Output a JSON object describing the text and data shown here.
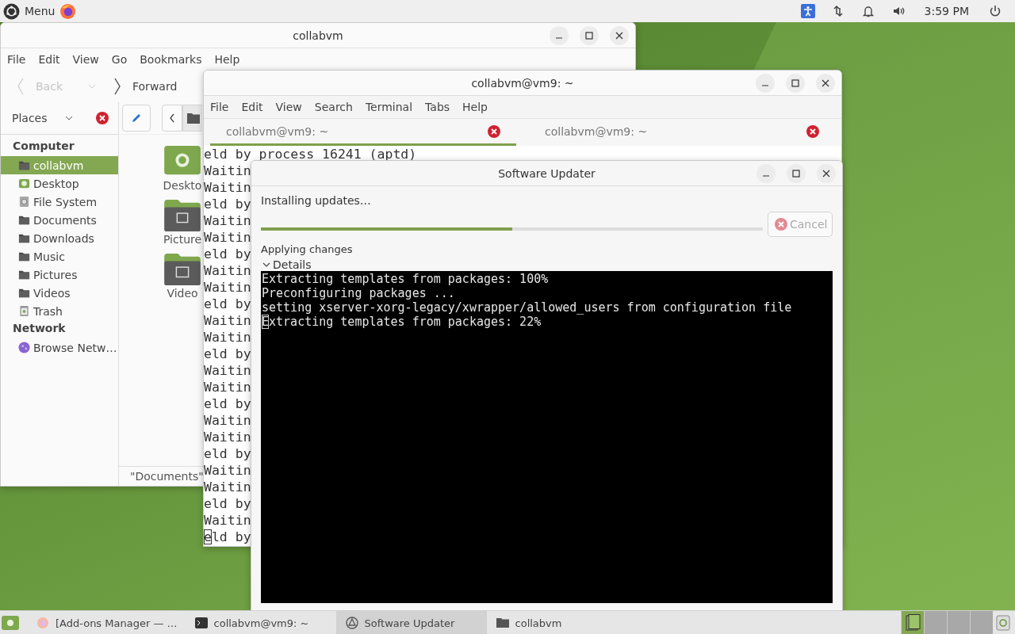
{
  "top_panel": {
    "menu_label": "Menu",
    "clock": "3:59 PM"
  },
  "file_manager": {
    "title": "collabvm",
    "menu": [
      "File",
      "Edit",
      "View",
      "Go",
      "Bookmarks",
      "Help"
    ],
    "toolbar": [
      {
        "kind": "back",
        "label": "Back",
        "disabled": true
      },
      {
        "kind": "forward",
        "label": "Forward",
        "disabled": false
      }
    ],
    "places_label": "Places",
    "sidebar": [
      {
        "heading": "Computer",
        "items": [
          {
            "label": "collabvm",
            "kind": "home",
            "selected": true
          },
          {
            "label": "Desktop",
            "kind": "desktop",
            "selected": false
          },
          {
            "label": "File System",
            "kind": "drive",
            "selected": false
          },
          {
            "label": "Documents",
            "kind": "folder",
            "selected": false
          },
          {
            "label": "Downloads",
            "kind": "folder",
            "selected": false
          },
          {
            "label": "Music",
            "kind": "folder",
            "selected": false
          },
          {
            "label": "Pictures",
            "kind": "folder",
            "selected": false
          },
          {
            "label": "Videos",
            "kind": "folder",
            "selected": false
          },
          {
            "label": "Trash",
            "kind": "trash",
            "selected": false
          }
        ]
      },
      {
        "heading": "Network",
        "items": [
          {
            "label": "Browse Netw…",
            "kind": "network",
            "selected": false
          }
        ]
      }
    ],
    "files": [
      {
        "label": "Deskto",
        "kind": "desktop"
      },
      {
        "label": "Picture",
        "kind": "pictures"
      },
      {
        "label": "Video",
        "kind": "videos"
      }
    ],
    "status": "\"Documents\""
  },
  "terminal": {
    "title": "collabvm@vm9: ~",
    "menu": [
      "File",
      "Edit",
      "View",
      "Search",
      "Terminal",
      "Tabs",
      "Help"
    ],
    "tabs": [
      {
        "label": "collabvm@vm9: ~",
        "selected": true
      },
      {
        "label": "collabvm@vm9: ~",
        "selected": false
      }
    ],
    "lines": [
      {
        "text": "eld by process 16241 (aptd)",
        "cursor": false
      },
      {
        "text": "Waitin",
        "cursor": false
      },
      {
        "text": "Waitin",
        "cursor": false
      },
      {
        "text": "eld by",
        "cursor": false
      },
      {
        "text": "Waitin",
        "cursor": false
      },
      {
        "text": "Waitin",
        "cursor": false
      },
      {
        "text": "eld by",
        "cursor": false
      },
      {
        "text": "Waitin",
        "cursor": false
      },
      {
        "text": "Waitin",
        "cursor": false
      },
      {
        "text": "eld by",
        "cursor": false
      },
      {
        "text": "Waitin",
        "cursor": false
      },
      {
        "text": "Waitin",
        "cursor": false
      },
      {
        "text": "eld by",
        "cursor": false
      },
      {
        "text": "Waitin",
        "cursor": false
      },
      {
        "text": "Waitin",
        "cursor": false
      },
      {
        "text": "eld by",
        "cursor": false
      },
      {
        "text": "Waitin",
        "cursor": false
      },
      {
        "text": "Waitin",
        "cursor": false
      },
      {
        "text": "eld by",
        "cursor": false
      },
      {
        "text": "Waitin",
        "cursor": false
      },
      {
        "text": "Waitin",
        "cursor": false
      },
      {
        "text": "eld by",
        "cursor": false
      },
      {
        "text": "Waitin",
        "cursor": false
      },
      {
        "text": "eld by",
        "cursor": true
      }
    ]
  },
  "updater": {
    "title": "Software Updater",
    "status": "Installing updates…",
    "progress": {
      "level": 0.5
    },
    "cancel": {
      "label": "Cancel",
      "disabled": true
    },
    "phase": "Applying changes",
    "details": {
      "label": "Details",
      "expanded": true
    },
    "console": [
      {
        "text": "Extracting templates from packages: 100%",
        "cursor": false
      },
      {
        "text": "Preconfiguring packages ...",
        "cursor": false
      },
      {
        "text": "setting xserver-xorg-legacy/xwrapper/allowed_users from configuration file",
        "cursor": false
      },
      {
        "text": "Extracting templates from packages: 22%",
        "cursor": true
      }
    ]
  },
  "taskbar": [
    {
      "label": "[Add-ons Manager — …",
      "kind": "browser",
      "selected": false
    },
    {
      "label": "collabvm@vm9: ~",
      "kind": "terminal",
      "selected": false
    },
    {
      "label": "Software Updater",
      "kind": "updater",
      "selected": true
    },
    {
      "label": "collabvm",
      "kind": "folder",
      "selected": false
    }
  ]
}
